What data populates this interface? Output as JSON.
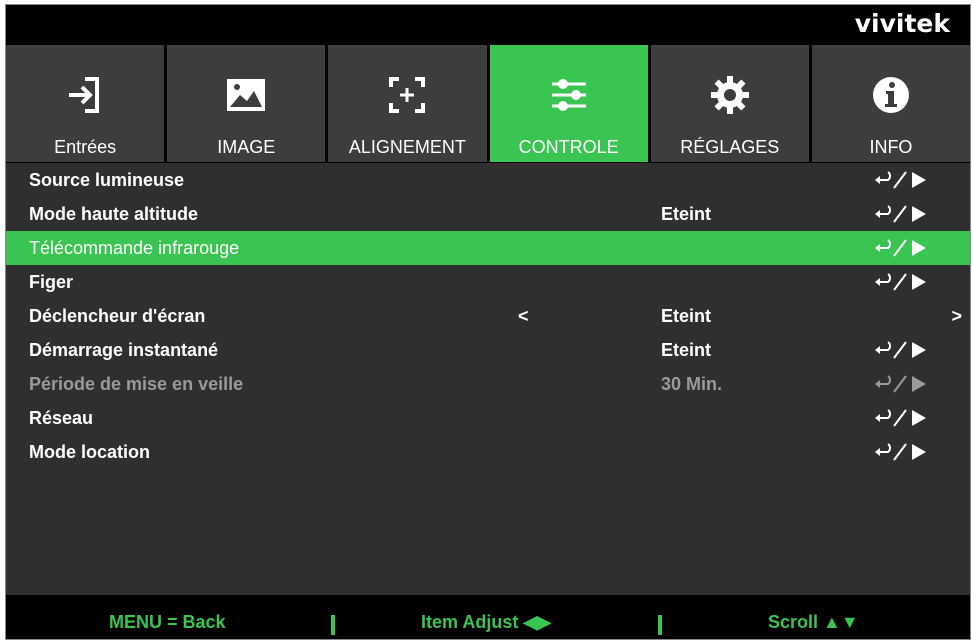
{
  "brand": {
    "logo_text": "vivitek"
  },
  "colors": {
    "accent": "#3ac452",
    "tab_bg": "#3d3d3d",
    "list_bg": "#2f2f2f",
    "disabled_text": "#9a9a9a"
  },
  "tabs": [
    {
      "label": "Entrées",
      "icon": "input-icon",
      "active": false
    },
    {
      "label": "IMAGE",
      "icon": "image-icon",
      "active": false
    },
    {
      "label": "ALIGNEMENT",
      "icon": "alignment-icon",
      "active": false
    },
    {
      "label": "CONTROLE",
      "icon": "sliders-icon",
      "active": true
    },
    {
      "label": "RÉGLAGES",
      "icon": "gear-icon",
      "active": false
    },
    {
      "label": "INFO",
      "icon": "info-icon",
      "active": false
    }
  ],
  "menu_items": [
    {
      "name": "Source lumineuse",
      "value": "",
      "control": "enter"
    },
    {
      "name": "Mode haute altitude",
      "value": "Eteint",
      "control": "enter"
    },
    {
      "name": "Télécommande infrarouge",
      "value": "",
      "control": "enter",
      "selected": true
    },
    {
      "name": "Figer",
      "value": "",
      "control": "enter"
    },
    {
      "name": "Déclencheur d'écran",
      "value": "Eteint",
      "control": "arrows",
      "left_arrow": "<",
      "right_arrow": ">"
    },
    {
      "name": "Démarrage instantané",
      "value": "Eteint",
      "control": "enter"
    },
    {
      "name": "Période de mise en veille",
      "value": "30 Min.",
      "control": "enter",
      "disabled": true
    },
    {
      "name": "Réseau",
      "value": "",
      "control": "enter"
    },
    {
      "name": "Mode location",
      "value": "",
      "control": "enter"
    }
  ],
  "footer": {
    "back": "MENU = Back",
    "adjust": "Item Adjust ◀▶",
    "scroll": "Scroll ▲▼"
  }
}
